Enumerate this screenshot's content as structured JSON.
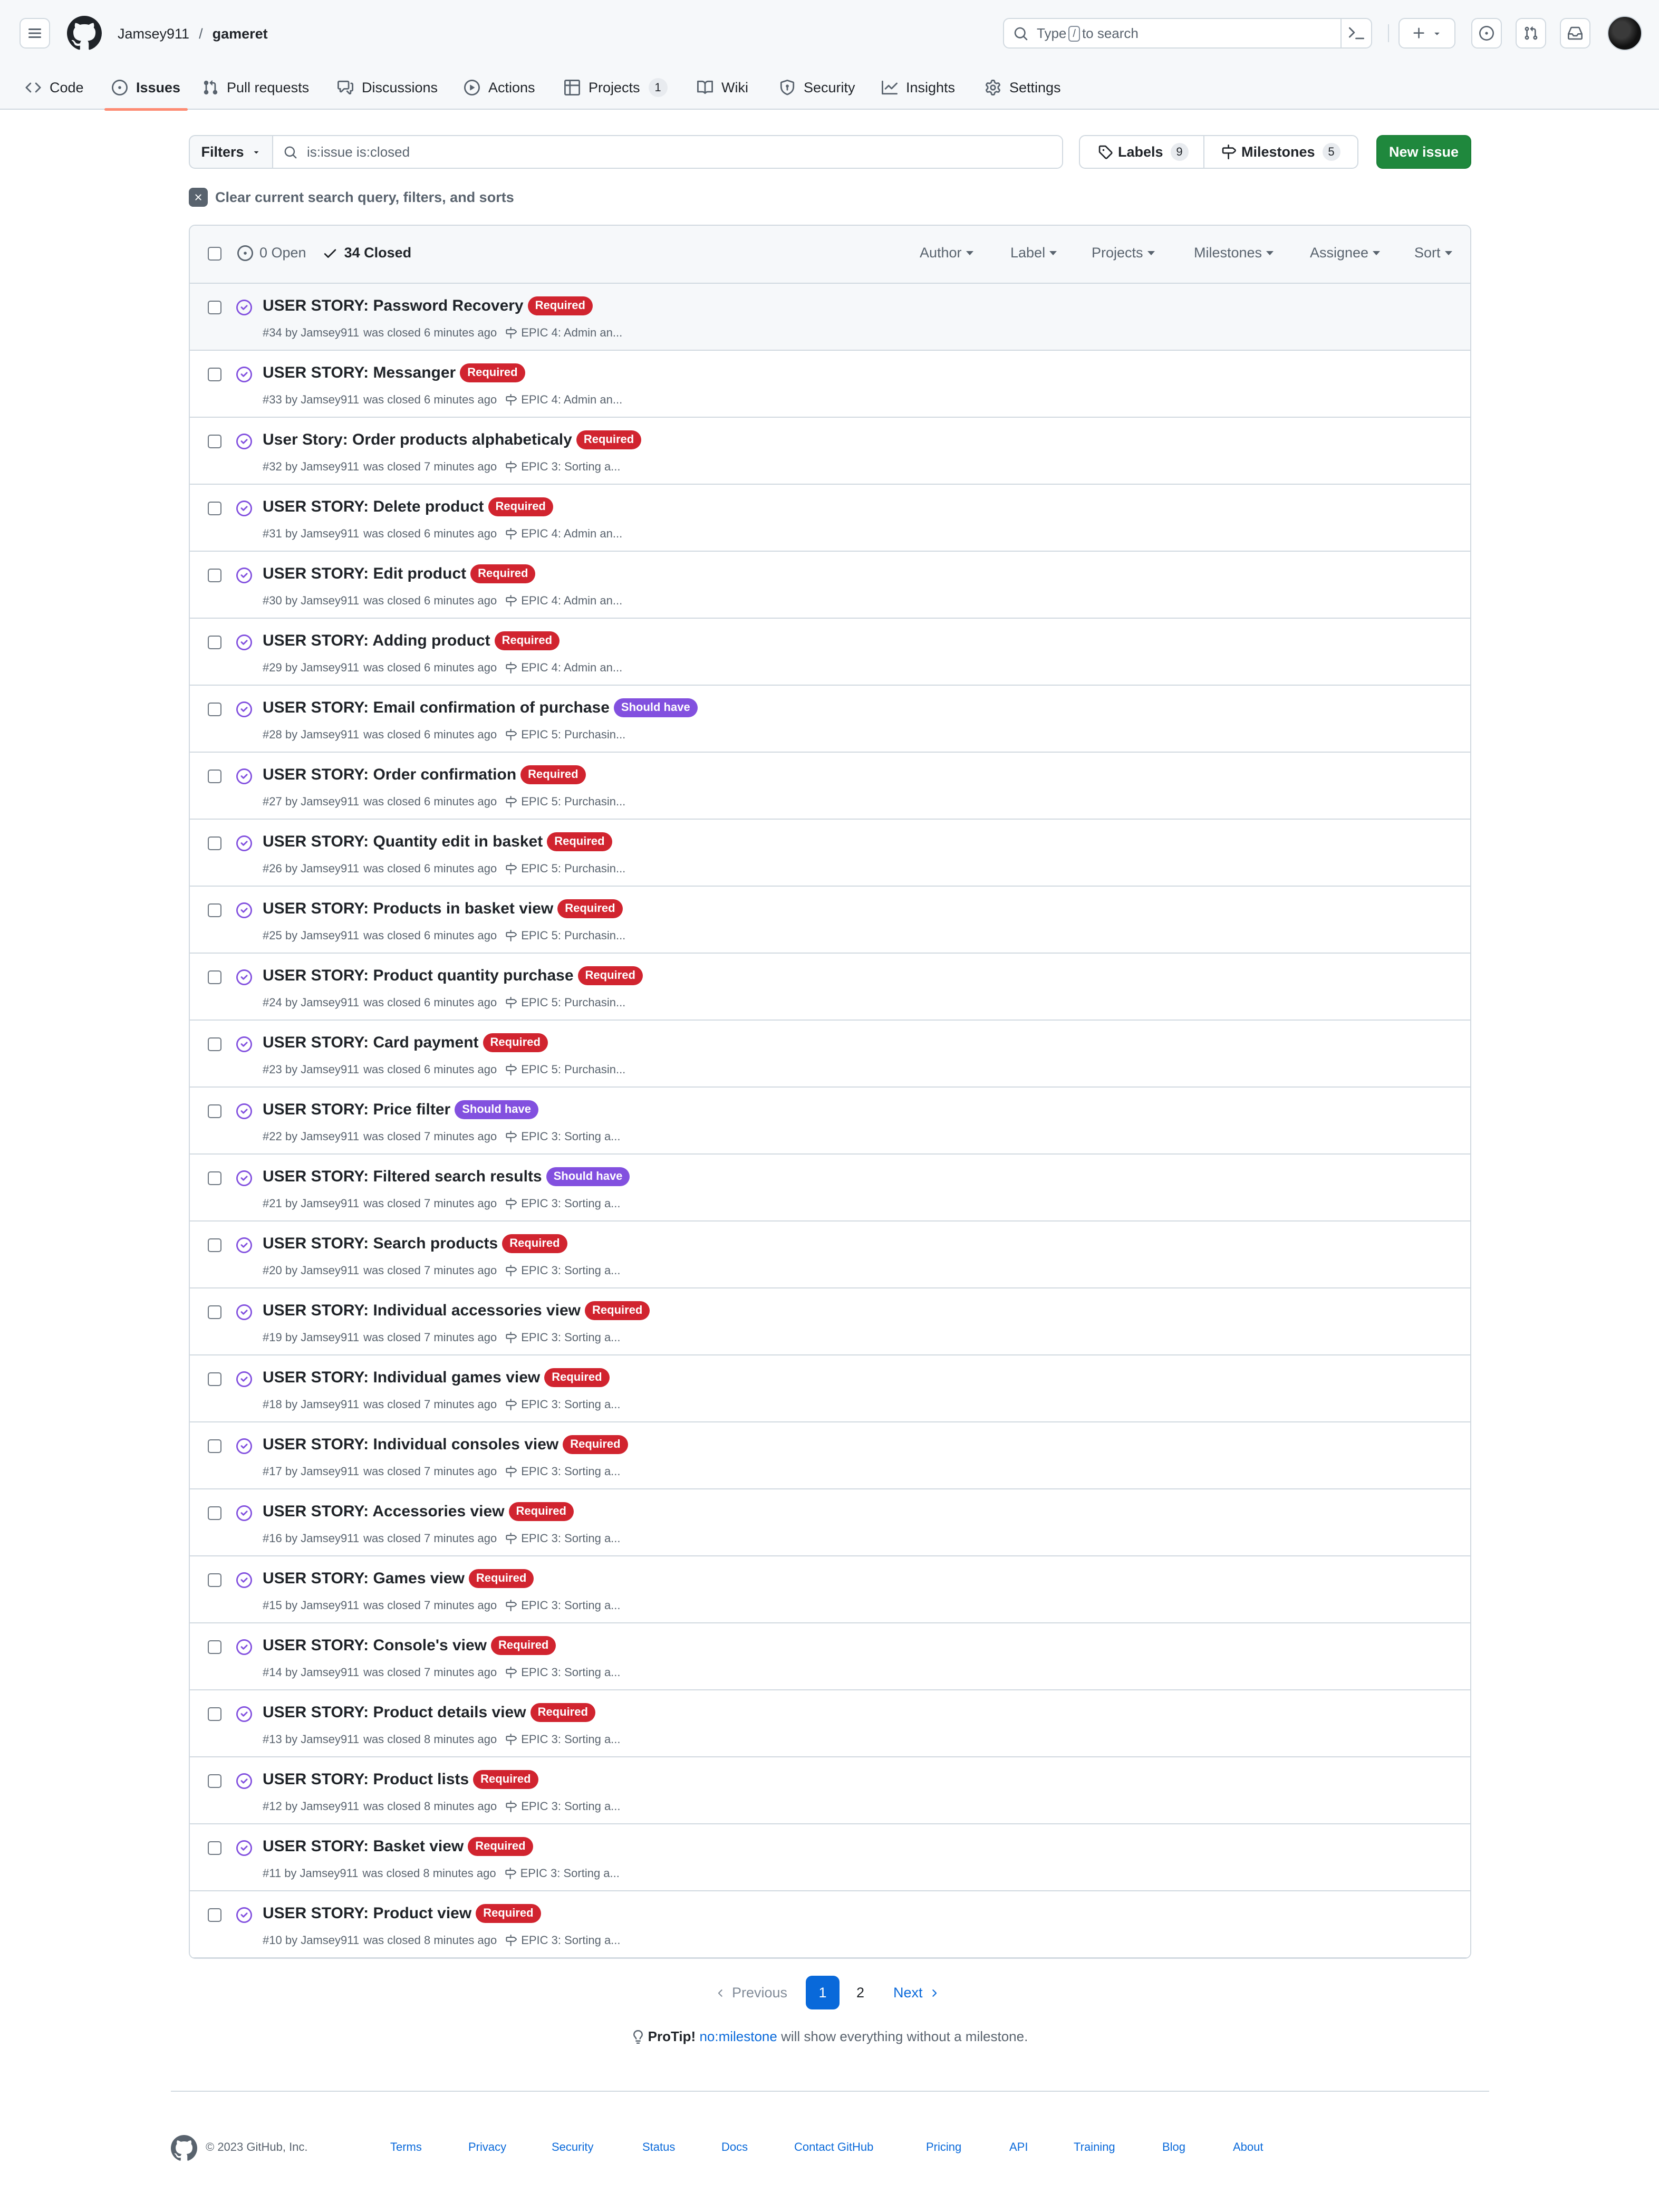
{
  "header": {
    "owner": "Jamsey911",
    "separator": "/",
    "repo": "gameret",
    "search_placeholder_pre": "Type",
    "search_key": "/",
    "search_placeholder_post": "to search"
  },
  "repo_nav": [
    {
      "label": "Code",
      "icon": "code-icon"
    },
    {
      "label": "Issues",
      "icon": "issue-opened-icon",
      "active": true
    },
    {
      "label": "Pull requests",
      "icon": "git-pull-request-icon"
    },
    {
      "label": "Discussions",
      "icon": "comment-discussion-icon"
    },
    {
      "label": "Actions",
      "icon": "play-icon"
    },
    {
      "label": "Projects",
      "icon": "table-icon",
      "count": "1"
    },
    {
      "label": "Wiki",
      "icon": "book-icon"
    },
    {
      "label": "Security",
      "icon": "shield-icon"
    },
    {
      "label": "Insights",
      "icon": "graph-icon"
    },
    {
      "label": "Settings",
      "icon": "gear-icon"
    }
  ],
  "filters": {
    "button_label": "Filters",
    "query": "is:issue is:closed",
    "labels_label": "Labels",
    "labels_count": "9",
    "milestones_label": "Milestones",
    "milestones_count": "5",
    "new_issue_label": "New issue",
    "clear_label": "Clear current search query, filters, and sorts"
  },
  "list_header": {
    "open_label": "0 Open",
    "closed_label": "34 Closed",
    "sorters": [
      "Author",
      "Label",
      "Projects",
      "Milestones",
      "Assignee",
      "Sort"
    ]
  },
  "colors": {
    "required": "#d1242f",
    "should_have": "#8250df",
    "closed_icon": "#8250df",
    "accent": "#0969da",
    "primary_button": "#1f883d"
  },
  "issues": [
    {
      "title": "USER STORY: Password Recovery",
      "label": "Required",
      "number": "#34",
      "author": "Jamsey911",
      "closed": "was closed 6 minutes ago",
      "milestone": "EPIC 4: Admin an..."
    },
    {
      "title": "USER STORY: Messanger",
      "label": "Required",
      "number": "#33",
      "author": "Jamsey911",
      "closed": "was closed 6 minutes ago",
      "milestone": "EPIC 4: Admin an..."
    },
    {
      "title": "User Story: Order products alphabeticaly",
      "label": "Required",
      "number": "#32",
      "author": "Jamsey911",
      "closed": "was closed 7 minutes ago",
      "milestone": "EPIC 3: Sorting a..."
    },
    {
      "title": "USER STORY: Delete product",
      "label": "Required",
      "number": "#31",
      "author": "Jamsey911",
      "closed": "was closed 6 minutes ago",
      "milestone": "EPIC 4: Admin an..."
    },
    {
      "title": "USER STORY: Edit product",
      "label": "Required",
      "number": "#30",
      "author": "Jamsey911",
      "closed": "was closed 6 minutes ago",
      "milestone": "EPIC 4: Admin an..."
    },
    {
      "title": "USER STORY: Adding product",
      "label": "Required",
      "number": "#29",
      "author": "Jamsey911",
      "closed": "was closed 6 minutes ago",
      "milestone": "EPIC 4: Admin an..."
    },
    {
      "title": "USER STORY: Email confirmation of purchase",
      "label": "Should have",
      "number": "#28",
      "author": "Jamsey911",
      "closed": "was closed 6 minutes ago",
      "milestone": "EPIC 5: Purchasin..."
    },
    {
      "title": "USER STORY: Order confirmation",
      "label": "Required",
      "number": "#27",
      "author": "Jamsey911",
      "closed": "was closed 6 minutes ago",
      "milestone": "EPIC 5: Purchasin..."
    },
    {
      "title": "USER STORY: Quantity edit in basket",
      "label": "Required",
      "number": "#26",
      "author": "Jamsey911",
      "closed": "was closed 6 minutes ago",
      "milestone": "EPIC 5: Purchasin..."
    },
    {
      "title": "USER STORY: Products in basket view",
      "label": "Required",
      "number": "#25",
      "author": "Jamsey911",
      "closed": "was closed 6 minutes ago",
      "milestone": "EPIC 5: Purchasin..."
    },
    {
      "title": "USER STORY: Product quantity purchase",
      "label": "Required",
      "number": "#24",
      "author": "Jamsey911",
      "closed": "was closed 6 minutes ago",
      "milestone": "EPIC 5: Purchasin..."
    },
    {
      "title": "USER STORY: Card payment",
      "label": "Required",
      "number": "#23",
      "author": "Jamsey911",
      "closed": "was closed 6 minutes ago",
      "milestone": "EPIC 5: Purchasin..."
    },
    {
      "title": "USER STORY: Price filter",
      "label": "Should have",
      "number": "#22",
      "author": "Jamsey911",
      "closed": "was closed 7 minutes ago",
      "milestone": "EPIC 3: Sorting a..."
    },
    {
      "title": "USER STORY: Filtered search results",
      "label": "Should have",
      "number": "#21",
      "author": "Jamsey911",
      "closed": "was closed 7 minutes ago",
      "milestone": "EPIC 3: Sorting a..."
    },
    {
      "title": "USER STORY: Search products",
      "label": "Required",
      "number": "#20",
      "author": "Jamsey911",
      "closed": "was closed 7 minutes ago",
      "milestone": "EPIC 3: Sorting a..."
    },
    {
      "title": "USER STORY: Individual accessories view",
      "label": "Required",
      "number": "#19",
      "author": "Jamsey911",
      "closed": "was closed 7 minutes ago",
      "milestone": "EPIC 3: Sorting a..."
    },
    {
      "title": "USER STORY: Individual games view",
      "label": "Required",
      "number": "#18",
      "author": "Jamsey911",
      "closed": "was closed 7 minutes ago",
      "milestone": "EPIC 3: Sorting a..."
    },
    {
      "title": "USER STORY: Individual consoles view",
      "label": "Required",
      "number": "#17",
      "author": "Jamsey911",
      "closed": "was closed 7 minutes ago",
      "milestone": "EPIC 3: Sorting a..."
    },
    {
      "title": "USER STORY: Accessories view",
      "label": "Required",
      "number": "#16",
      "author": "Jamsey911",
      "closed": "was closed 7 minutes ago",
      "milestone": "EPIC 3: Sorting a..."
    },
    {
      "title": "USER STORY: Games view",
      "label": "Required",
      "number": "#15",
      "author": "Jamsey911",
      "closed": "was closed 7 minutes ago",
      "milestone": "EPIC 3: Sorting a..."
    },
    {
      "title": "USER STORY: Console's view",
      "label": "Required",
      "number": "#14",
      "author": "Jamsey911",
      "closed": "was closed 7 minutes ago",
      "milestone": "EPIC 3: Sorting a..."
    },
    {
      "title": "USER STORY: Product details view",
      "label": "Required",
      "number": "#13",
      "author": "Jamsey911",
      "closed": "was closed 8 minutes ago",
      "milestone": "EPIC 3: Sorting a..."
    },
    {
      "title": "USER STORY: Product lists",
      "label": "Required",
      "number": "#12",
      "author": "Jamsey911",
      "closed": "was closed 8 minutes ago",
      "milestone": "EPIC 3: Sorting a..."
    },
    {
      "title": "USER STORY: Basket view",
      "label": "Required",
      "number": "#11",
      "author": "Jamsey911",
      "closed": "was closed 8 minutes ago",
      "milestone": "EPIC 3: Sorting a..."
    },
    {
      "title": "USER STORY: Product view",
      "label": "Required",
      "number": "#10",
      "author": "Jamsey911",
      "closed": "was closed 8 minutes ago",
      "milestone": "EPIC 3: Sorting a..."
    }
  ],
  "pagination": {
    "previous": "Previous",
    "pages": [
      "1",
      "2"
    ],
    "current": "1",
    "next": "Next"
  },
  "protip": {
    "lead": "ProTip!",
    "link": "no:milestone",
    "text": "will show everything without a milestone."
  },
  "footer": {
    "copyright": "© 2023 GitHub, Inc.",
    "links": [
      "Terms",
      "Privacy",
      "Security",
      "Status",
      "Docs",
      "Contact GitHub",
      "Pricing",
      "API",
      "Training",
      "Blog",
      "About"
    ]
  }
}
